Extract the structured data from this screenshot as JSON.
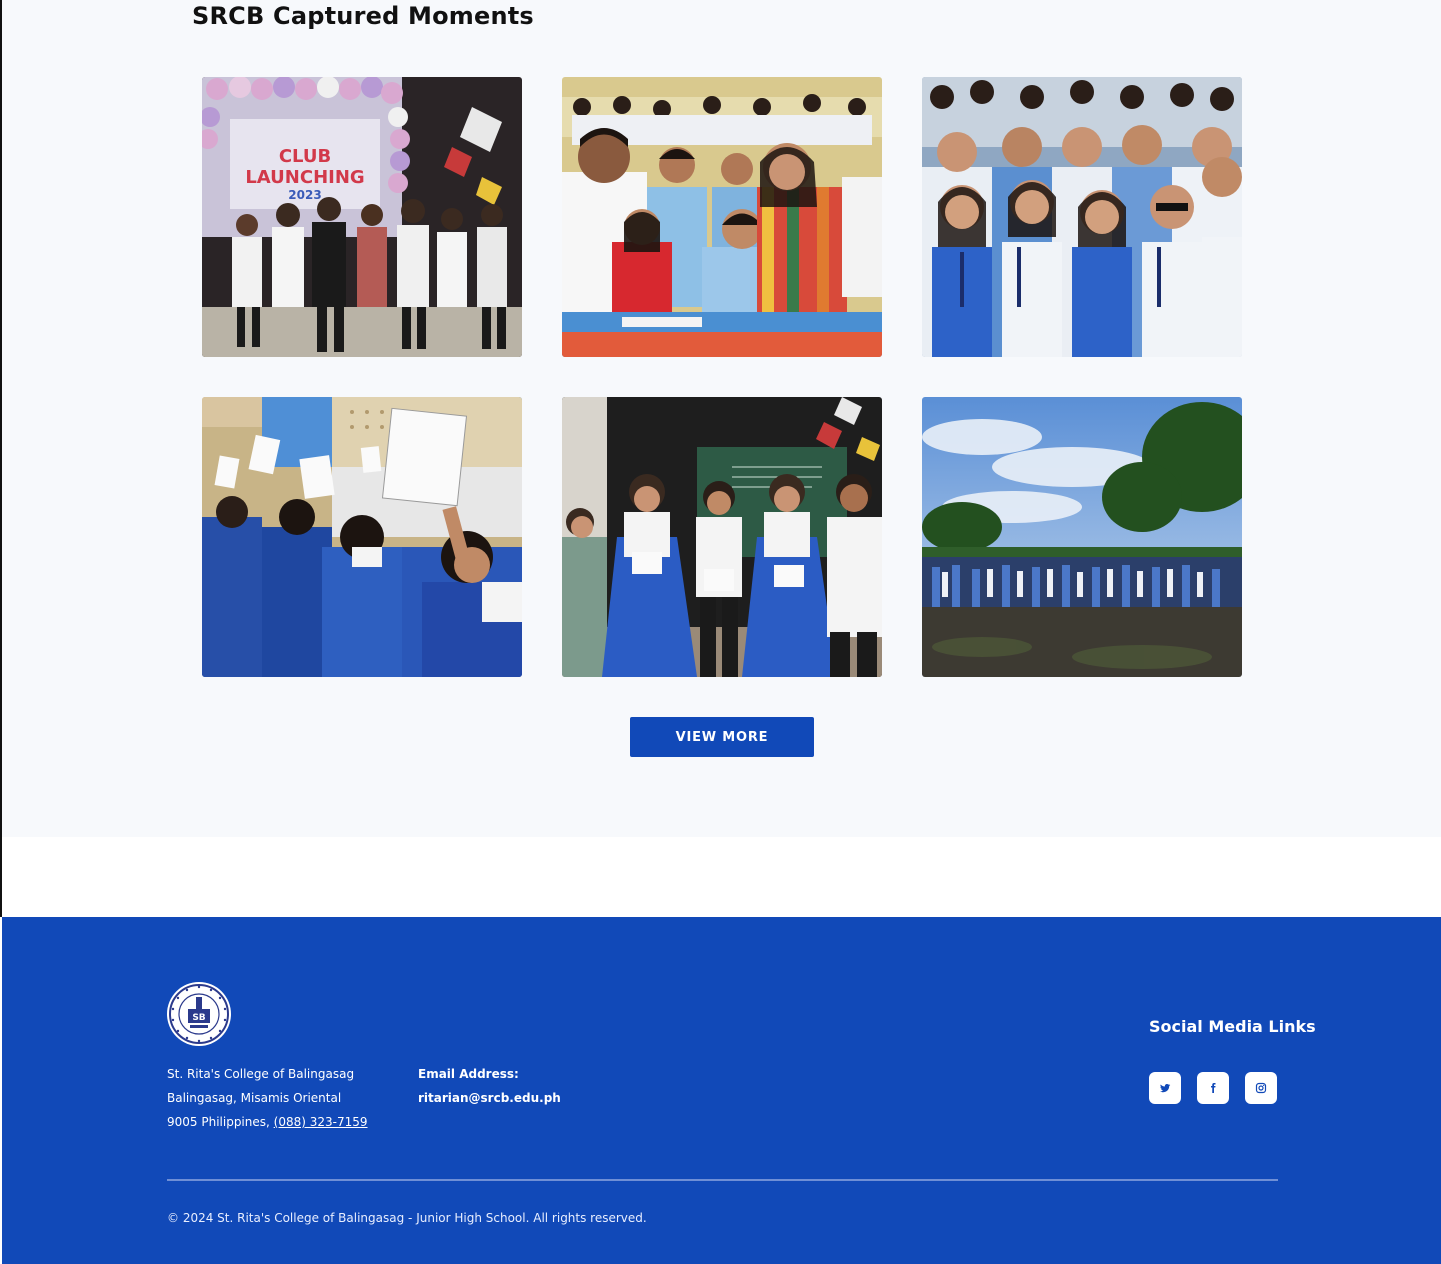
{
  "gallery": {
    "title": "SRCB Captured Moments",
    "photos": [
      {
        "name": "club-launching-dance-photo"
      },
      {
        "name": "students-with-teacher-photo"
      },
      {
        "name": "students-group-selfie-photo"
      },
      {
        "name": "students-raising-boards-photo"
      },
      {
        "name": "award-recipients-photo"
      },
      {
        "name": "outdoor-assembly-photo"
      }
    ],
    "view_more_label": "VIEW MORE"
  },
  "footer": {
    "address_line1": "St. Rita's College of Balingasag",
    "address_line2": "Balingasag, Misamis Oriental",
    "address_line3_prefix": "9005 Philippines,",
    "phone": "(088) 323-7159",
    "email_label": "Email Address:",
    "email": "ritarian@srcb.edu.ph",
    "social_title": "Social Media Links",
    "social": [
      {
        "icon": "twitter-icon"
      },
      {
        "icon": "facebook-icon"
      },
      {
        "icon": "instagram-icon"
      }
    ],
    "copyright": "© 2024 St. Rita's College of Balingasag - Junior High School. All rights reserved.",
    "colors": {
      "brand": "#1149b8",
      "background": "#f7f9fc"
    }
  }
}
